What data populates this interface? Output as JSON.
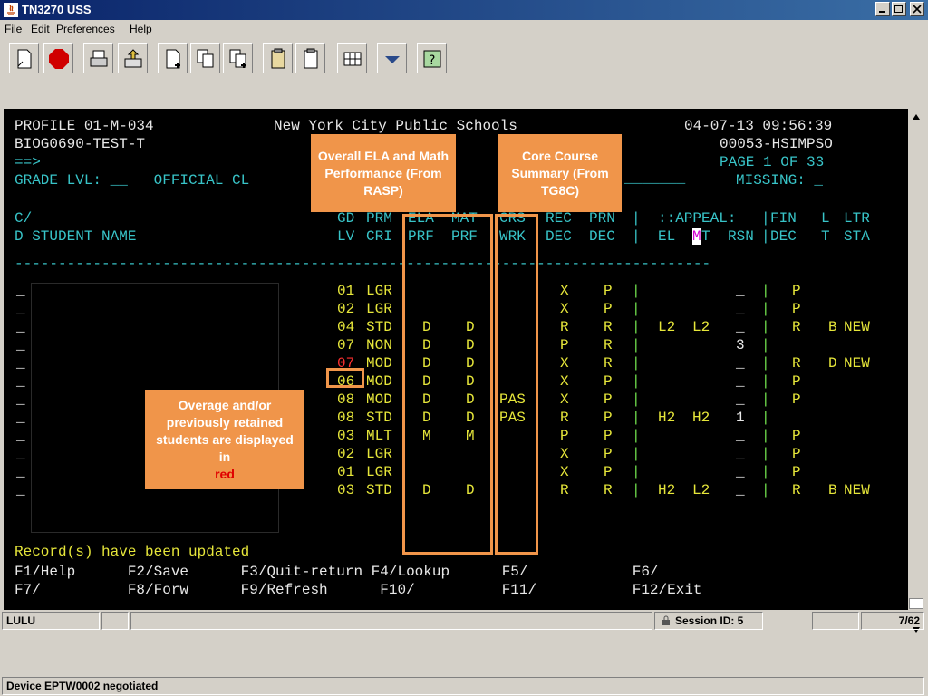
{
  "window": {
    "title": "TN3270  USS"
  },
  "menu": [
    "File",
    "Edit",
    "Preferences",
    "Help"
  ],
  "toolbar": [
    "new-session-icon",
    "stop-icon",
    "print-icon",
    "transfer-icon",
    "new-doc-icon",
    "copy-icon",
    "copy-append-icon",
    "paste-icon",
    "paste-clip-icon",
    "grid-icon",
    "dropdown-icon",
    "help-icon"
  ],
  "header": {
    "line1": {
      "left": "PROFILE 01-M-034",
      "mid": "New York City Public Schools",
      "right": "04-07-13 09:56:39"
    },
    "line2": {
      "left": "BIOG0690-TEST-T",
      "right": "00053-HSIMPSO"
    },
    "line3": {
      "left": "==>",
      "right": "PAGE 1 OF 33"
    },
    "line4": {
      "left": "GRADE LVL: __   OFFICIAL CL",
      "right": "MISSING: _"
    }
  },
  "columns": {
    "row1": {
      "cd": "C/",
      "gd": "GD",
      "prm": "PRM",
      "ela": "ELA",
      "mat": "MAT",
      "crs": "CRS",
      "rec": "REC",
      "prn": "PRN",
      "appeal": "::APPEAL:",
      "fin": "FIN",
      "l": "L",
      "ltr": "LTR"
    },
    "row2": {
      "cd": "D STUDENT NAME",
      "gd": "LV",
      "prm": "CRI",
      "ela": "PRF",
      "mat": "PRF",
      "crs": "WRK",
      "rec": "DEC",
      "prn": "DEC",
      "el": "EL",
      "mt_m": "M",
      "mt_t": "T",
      "rsn": "RSN",
      "fin": "DEC",
      "l": "T",
      "ltr": "STA"
    }
  },
  "separator": "--------------------------------------------------------------------------------",
  "rows": [
    {
      "sel": "_",
      "gd": "01",
      "prm": "LGR",
      "ela": "",
      "mat": "",
      "crs": "",
      "rec": "X",
      "prn": "P",
      "el": "",
      "mt": "",
      "rsn": "_",
      "fin": "P",
      "l": "",
      "ltr": "",
      "gd_red": false
    },
    {
      "sel": "_",
      "gd": "02",
      "prm": "LGR",
      "ela": "",
      "mat": "",
      "crs": "",
      "rec": "X",
      "prn": "P",
      "el": "",
      "mt": "",
      "rsn": "_",
      "fin": "P",
      "l": "",
      "ltr": "",
      "gd_red": false
    },
    {
      "sel": "_",
      "gd": "04",
      "prm": "STD",
      "ela": "D",
      "mat": "D",
      "crs": "",
      "rec": "R",
      "prn": "R",
      "el": "L2",
      "mt": "L2",
      "rsn": "_",
      "fin": "R",
      "l": "B",
      "ltr": "NEW",
      "gd_red": false
    },
    {
      "sel": "_",
      "gd": "07",
      "prm": "NON",
      "ela": "D",
      "mat": "D",
      "crs": "",
      "rec": "P",
      "prn": "R",
      "el": "",
      "mt": "",
      "rsn": "3",
      "fin": "",
      "l": "",
      "ltr": "",
      "gd_red": false
    },
    {
      "sel": "_",
      "gd": "07",
      "prm": "MOD",
      "ela": "D",
      "mat": "D",
      "crs": "",
      "rec": "X",
      "prn": "R",
      "el": "",
      "mt": "",
      "rsn": "_",
      "fin": "R",
      "l": "D",
      "ltr": "NEW",
      "gd_red": true
    },
    {
      "sel": "_",
      "gd": "06",
      "prm": "MOD",
      "ela": "D",
      "mat": "D",
      "crs": "",
      "rec": "X",
      "prn": "P",
      "el": "",
      "mt": "",
      "rsn": "_",
      "fin": "P",
      "l": "",
      "ltr": "",
      "gd_red": false
    },
    {
      "sel": "_",
      "gd": "08",
      "prm": "MOD",
      "ela": "D",
      "mat": "D",
      "crs": "PAS",
      "rec": "X",
      "prn": "P",
      "el": "",
      "mt": "",
      "rsn": "_",
      "fin": "P",
      "l": "",
      "ltr": "",
      "gd_red": false
    },
    {
      "sel": "_",
      "gd": "08",
      "prm": "STD",
      "ela": "D",
      "mat": "D",
      "crs": "PAS",
      "rec": "R",
      "prn": "P",
      "el": "H2",
      "mt": "H2",
      "rsn": "1",
      "fin": "",
      "l": "",
      "ltr": "",
      "gd_red": false
    },
    {
      "sel": "_",
      "gd": "03",
      "prm": "MLT",
      "ela": "M",
      "mat": "M",
      "crs": "",
      "rec": "P",
      "prn": "P",
      "el": "",
      "mt": "",
      "rsn": "_",
      "fin": "P",
      "l": "",
      "ltr": "",
      "gd_red": false
    },
    {
      "sel": "_",
      "gd": "02",
      "prm": "LGR",
      "ela": "",
      "mat": "",
      "crs": "",
      "rec": "X",
      "prn": "P",
      "el": "",
      "mt": "",
      "rsn": "_",
      "fin": "P",
      "l": "",
      "ltr": "",
      "gd_red": false
    },
    {
      "sel": "_",
      "gd": "01",
      "prm": "LGR",
      "ela": "",
      "mat": "",
      "crs": "",
      "rec": "X",
      "prn": "P",
      "el": "",
      "mt": "",
      "rsn": "_",
      "fin": "P",
      "l": "",
      "ltr": "",
      "gd_red": false
    },
    {
      "sel": "_",
      "gd": "03",
      "prm": "STD",
      "ela": "D",
      "mat": "D",
      "crs": "",
      "rec": "R",
      "prn": "R",
      "el": "H2",
      "mt": "L2",
      "rsn": "_",
      "fin": "R",
      "l": "B",
      "ltr": "NEW",
      "gd_red": false
    }
  ],
  "message": "Record(s) have been updated",
  "fkeys": {
    "line1": "F1/Help      F2/Save      F3/Quit-return F4/Lookup      F5/            F6/",
    "line2": "F7/          F8/Forw      F9/Refresh      F10/          F11/           F12/Exit"
  },
  "callouts": {
    "ela_math": "Overall ELA and Math Performance (From RASP)",
    "core": "Core Course Summary (From TG8C)",
    "overage_prefix": "Overage and/or previously retained students are displayed in",
    "overage_red": "red"
  },
  "status": {
    "user": "LULU",
    "session": "Session ID: 5",
    "position": "7/62",
    "message": "Device EPTW0002 negotiated"
  },
  "colors": {
    "accent": "#f0954a",
    "screen_bg": "#000000",
    "yellow": "#e6e63a",
    "cyan": "#38c4c8",
    "green": "#6fdc4c",
    "red": "#ff3030",
    "title_bar": "#0a246a"
  }
}
